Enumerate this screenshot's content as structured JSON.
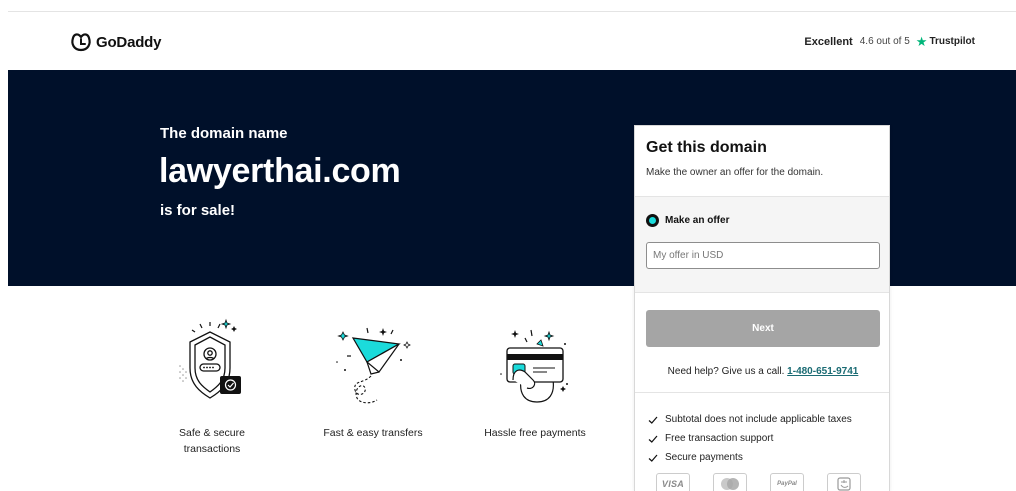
{
  "header": {
    "logo_text": "GoDaddy",
    "trust_excellent": "Excellent",
    "trust_score": "4.6 out of 5",
    "trust_brand": "Trustpilot",
    "trust_star_icon": "trustpilot-star-icon",
    "trust_color": "#00b67a"
  },
  "hero": {
    "line1": "The domain name",
    "domain": "lawyerthai.com",
    "line3": "is for sale!",
    "background": "#00102a"
  },
  "features": [
    {
      "label": "Safe & secure transactions",
      "icon": "shield-user-icon"
    },
    {
      "label": "Fast & easy transfers",
      "icon": "paper-plane-icon"
    },
    {
      "label": "Hassle free payments",
      "icon": "card-in-hand-icon"
    }
  ],
  "card": {
    "title": "Get this domain",
    "subtitle": "Make the owner an offer for the domain.",
    "radio_label": "Make an offer",
    "offer_placeholder": "My offer in USD",
    "next_label": "Next",
    "help_text": "Need help? Give us a call.",
    "help_phone": "1-480-651-9741",
    "bullets": [
      "Subtotal does not include applicable taxes",
      "Free transaction support",
      "Secure payments"
    ],
    "payment_methods": [
      "VISA",
      "",
      "PayPal",
      ""
    ],
    "accent_color": "#1bdbdb"
  }
}
